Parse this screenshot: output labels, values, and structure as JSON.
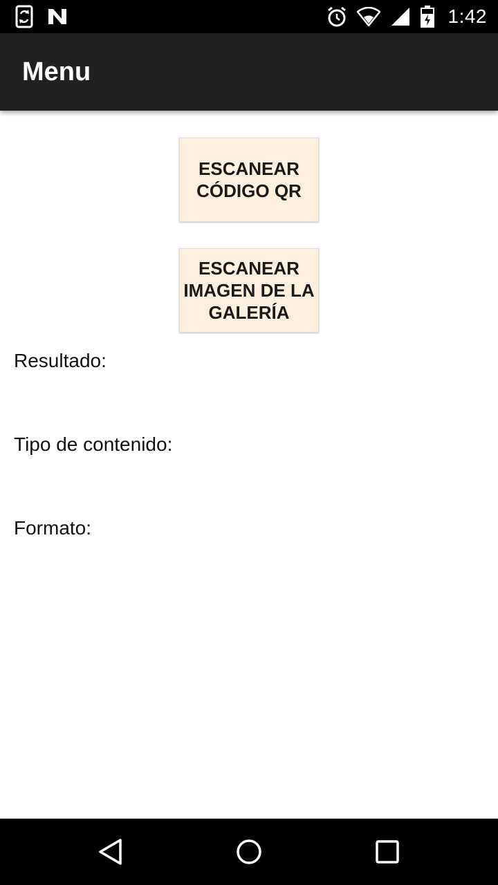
{
  "status_bar": {
    "time": "1:42",
    "icons_left": [
      "sync-phone-icon",
      "n-notification-icon"
    ],
    "icons_right": [
      "alarm-icon",
      "wifi-icon",
      "signal-icon",
      "battery-icon"
    ]
  },
  "app_bar": {
    "title": "Menu"
  },
  "buttons": {
    "scan_qr": "ESCANEAR CÓDIGO QR",
    "scan_gallery": "ESCANEAR IMAGEN DE LA GALERÍA"
  },
  "labels": {
    "result": "Resultado:",
    "content_type": "Tipo de contenido:",
    "format": "Formato:"
  },
  "nav_bar": {
    "icons": [
      "back-icon",
      "home-icon",
      "recents-icon"
    ]
  },
  "colors": {
    "status_bar": "#000000",
    "app_bar": "#212121",
    "button_bg": "#fdf0de",
    "nav_bar": "#000000"
  }
}
